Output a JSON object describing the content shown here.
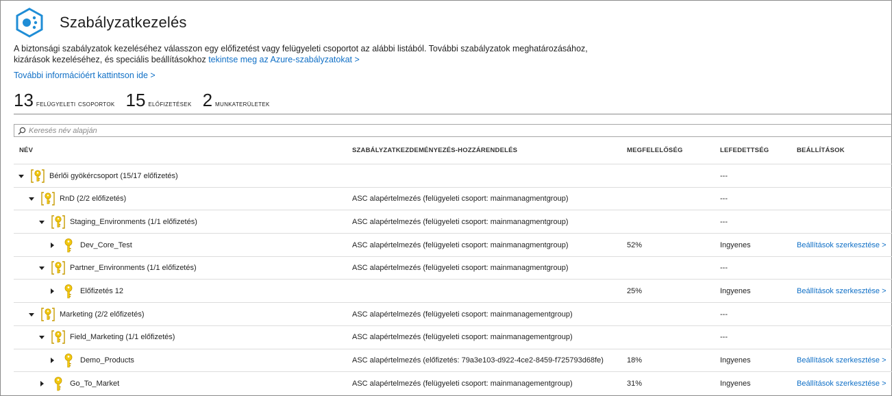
{
  "header": {
    "title": "Szabályzatkezelés"
  },
  "description": {
    "text": "A biztonsági szabályzatok kezeléséhez válasszon egy előfizetést vagy felügyeleti csoportot az alábbi listából. További szabályzatok meghatározásához, kizárások kezeléséhez, és speciális beállításokhoz ",
    "link": "tekintse meg az Azure-szabályzatokat >"
  },
  "more_info_link": "További információért kattintson ide >",
  "counters": [
    {
      "value": "13",
      "label": "Felügyeleti csoportok"
    },
    {
      "value": "15",
      "label": "Előfizetések"
    },
    {
      "value": "2",
      "label": "Munkaterületek"
    }
  ],
  "search": {
    "placeholder": "Keresés név alapján",
    "value": ""
  },
  "columns": {
    "name": "NÉV",
    "assignment": "SZABÁLYZATKEZDEMÉNYEZÉS-HOZZÁRENDELÉS",
    "compliance": "MEGFELELŐSÉG",
    "coverage": "LEFEDETTSÉG",
    "settings": "BEÁLLÍTÁSOK"
  },
  "rows": [
    {
      "level": 0,
      "type": "group",
      "expanded": true,
      "name": "Bérlői gyökércsoport (15/17 előfizetés)",
      "assignment": "",
      "compliance": "",
      "coverage": "---",
      "settings": ""
    },
    {
      "level": 1,
      "type": "group",
      "expanded": true,
      "name": "RnD (2/2 előfizetés)",
      "assignment": "ASC alapértelmezés (felügyeleti csoport: mainmanagmentgroup)",
      "compliance": "",
      "coverage": "---",
      "settings": ""
    },
    {
      "level": 2,
      "type": "group",
      "expanded": true,
      "name": "Staging_Environments (1/1 előfizetés)",
      "assignment": "ASC alapértelmezés (felügyeleti csoport: mainmanagmentgroup)",
      "compliance": "",
      "coverage": "---",
      "settings": ""
    },
    {
      "level": 3,
      "type": "subscription",
      "expanded": false,
      "name": "Dev_Core_Test",
      "assignment": "ASC alapértelmezés (felügyeleti csoport: mainmanagmentgroup)",
      "compliance": "52%",
      "coverage": "Ingyenes",
      "settings": "Beállítások szerkesztése >"
    },
    {
      "level": 2,
      "type": "group",
      "expanded": true,
      "name": "Partner_Environments (1/1 előfizetés)",
      "assignment": "ASC alapértelmezés (felügyeleti csoport: mainmanagmentgroup)",
      "compliance": "",
      "coverage": "---",
      "settings": ""
    },
    {
      "level": 3,
      "type": "subscription",
      "expanded": false,
      "name": "Előfizetés 12",
      "assignment": "",
      "compliance": "25%",
      "coverage": "Ingyenes",
      "settings": "Beállítások szerkesztése >"
    },
    {
      "level": 1,
      "type": "group",
      "expanded": true,
      "name": "Marketing (2/2 előfizetés)",
      "assignment": "ASC alapértelmezés (felügyeleti csoport: mainmanagementgroup)",
      "compliance": "",
      "coverage": "---",
      "settings": ""
    },
    {
      "level": 2,
      "type": "group",
      "expanded": true,
      "name": "Field_Marketing (1/1 előfizetés)",
      "assignment": "ASC alapértelmezés (felügyeleti csoport: mainmanagementgroup)",
      "compliance": "",
      "coverage": "---",
      "settings": ""
    },
    {
      "level": 3,
      "type": "subscription",
      "expanded": false,
      "name": "Demo_Products",
      "assignment": "ASC alapértelmezés (előfizetés: 79a3e103-d922-4ce2-8459-f725793d68fe)",
      "compliance": "18%",
      "coverage": "Ingyenes",
      "settings": "Beállítások szerkesztése >"
    },
    {
      "level": 2,
      "type": "subscription",
      "expanded": false,
      "name": "Go_To_Market",
      "assignment": "ASC alapértelmezés (felügyeleti csoport: mainmanagementgroup)",
      "compliance": "31%",
      "coverage": "Ingyenes",
      "settings": "Beállítások szerkesztése >"
    }
  ],
  "colors": {
    "link": "#0f6fc6",
    "key": "#f2c811",
    "key_dark": "#c79b00",
    "logo": "#1f8dd6"
  }
}
